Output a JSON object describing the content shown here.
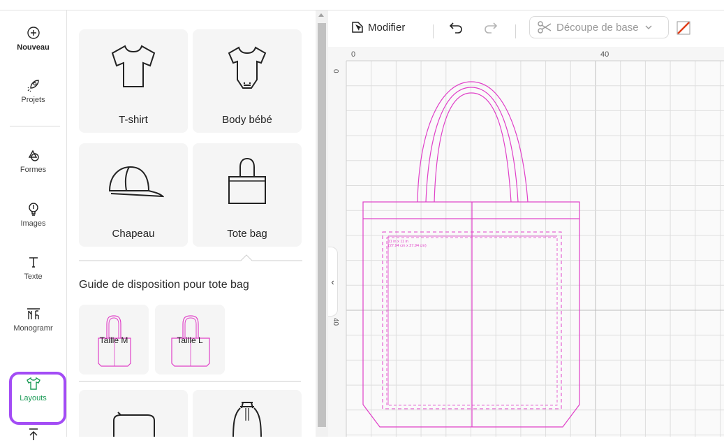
{
  "sidebar": {
    "items": [
      {
        "label": "Nouveau",
        "icon": "plus-circle-icon"
      },
      {
        "label": "Projets",
        "icon": "rocket-icon"
      },
      {
        "label": "Formes",
        "icon": "shapes-icon"
      },
      {
        "label": "Images",
        "icon": "bulb-icon"
      },
      {
        "label": "Texte",
        "icon": "text-icon"
      },
      {
        "label": "Monogramr",
        "icon": "monogram-icon"
      },
      {
        "label": "Layouts",
        "icon": "tshirt-icon"
      },
      {
        "label": "",
        "icon": "upload-icon"
      }
    ],
    "active_color": "#a34cf5",
    "active_item": "Layouts"
  },
  "panel": {
    "products": [
      {
        "label": "T-shirt",
        "icon": "tshirt-icon"
      },
      {
        "label": "Body bébé",
        "icon": "onesie-icon"
      },
      {
        "label": "Chapeau",
        "icon": "cap-icon"
      },
      {
        "label": "Tote bag",
        "icon": "tote-bag-icon"
      }
    ],
    "guide_title": "Guide de disposition pour tote bag",
    "guides": [
      {
        "label": "Taille M"
      },
      {
        "label": "Taille L"
      }
    ],
    "more_products": [
      {
        "icon": "pouch-icon"
      },
      {
        "icon": "drawstring-bag-icon"
      }
    ]
  },
  "toolbar": {
    "modify_label": "Modifier",
    "operation_label": "Découpe de base",
    "undo_icon": "undo-icon",
    "redo_icon": "redo-icon"
  },
  "canvas": {
    "ruler_top": [
      "0",
      "40"
    ],
    "ruler_left": [
      "0",
      "40"
    ],
    "design_label_line1": "11 in x 11 in",
    "design_label_line2": "(27.94 cm x 27.94 cm)",
    "line_color": "#e040c8"
  }
}
